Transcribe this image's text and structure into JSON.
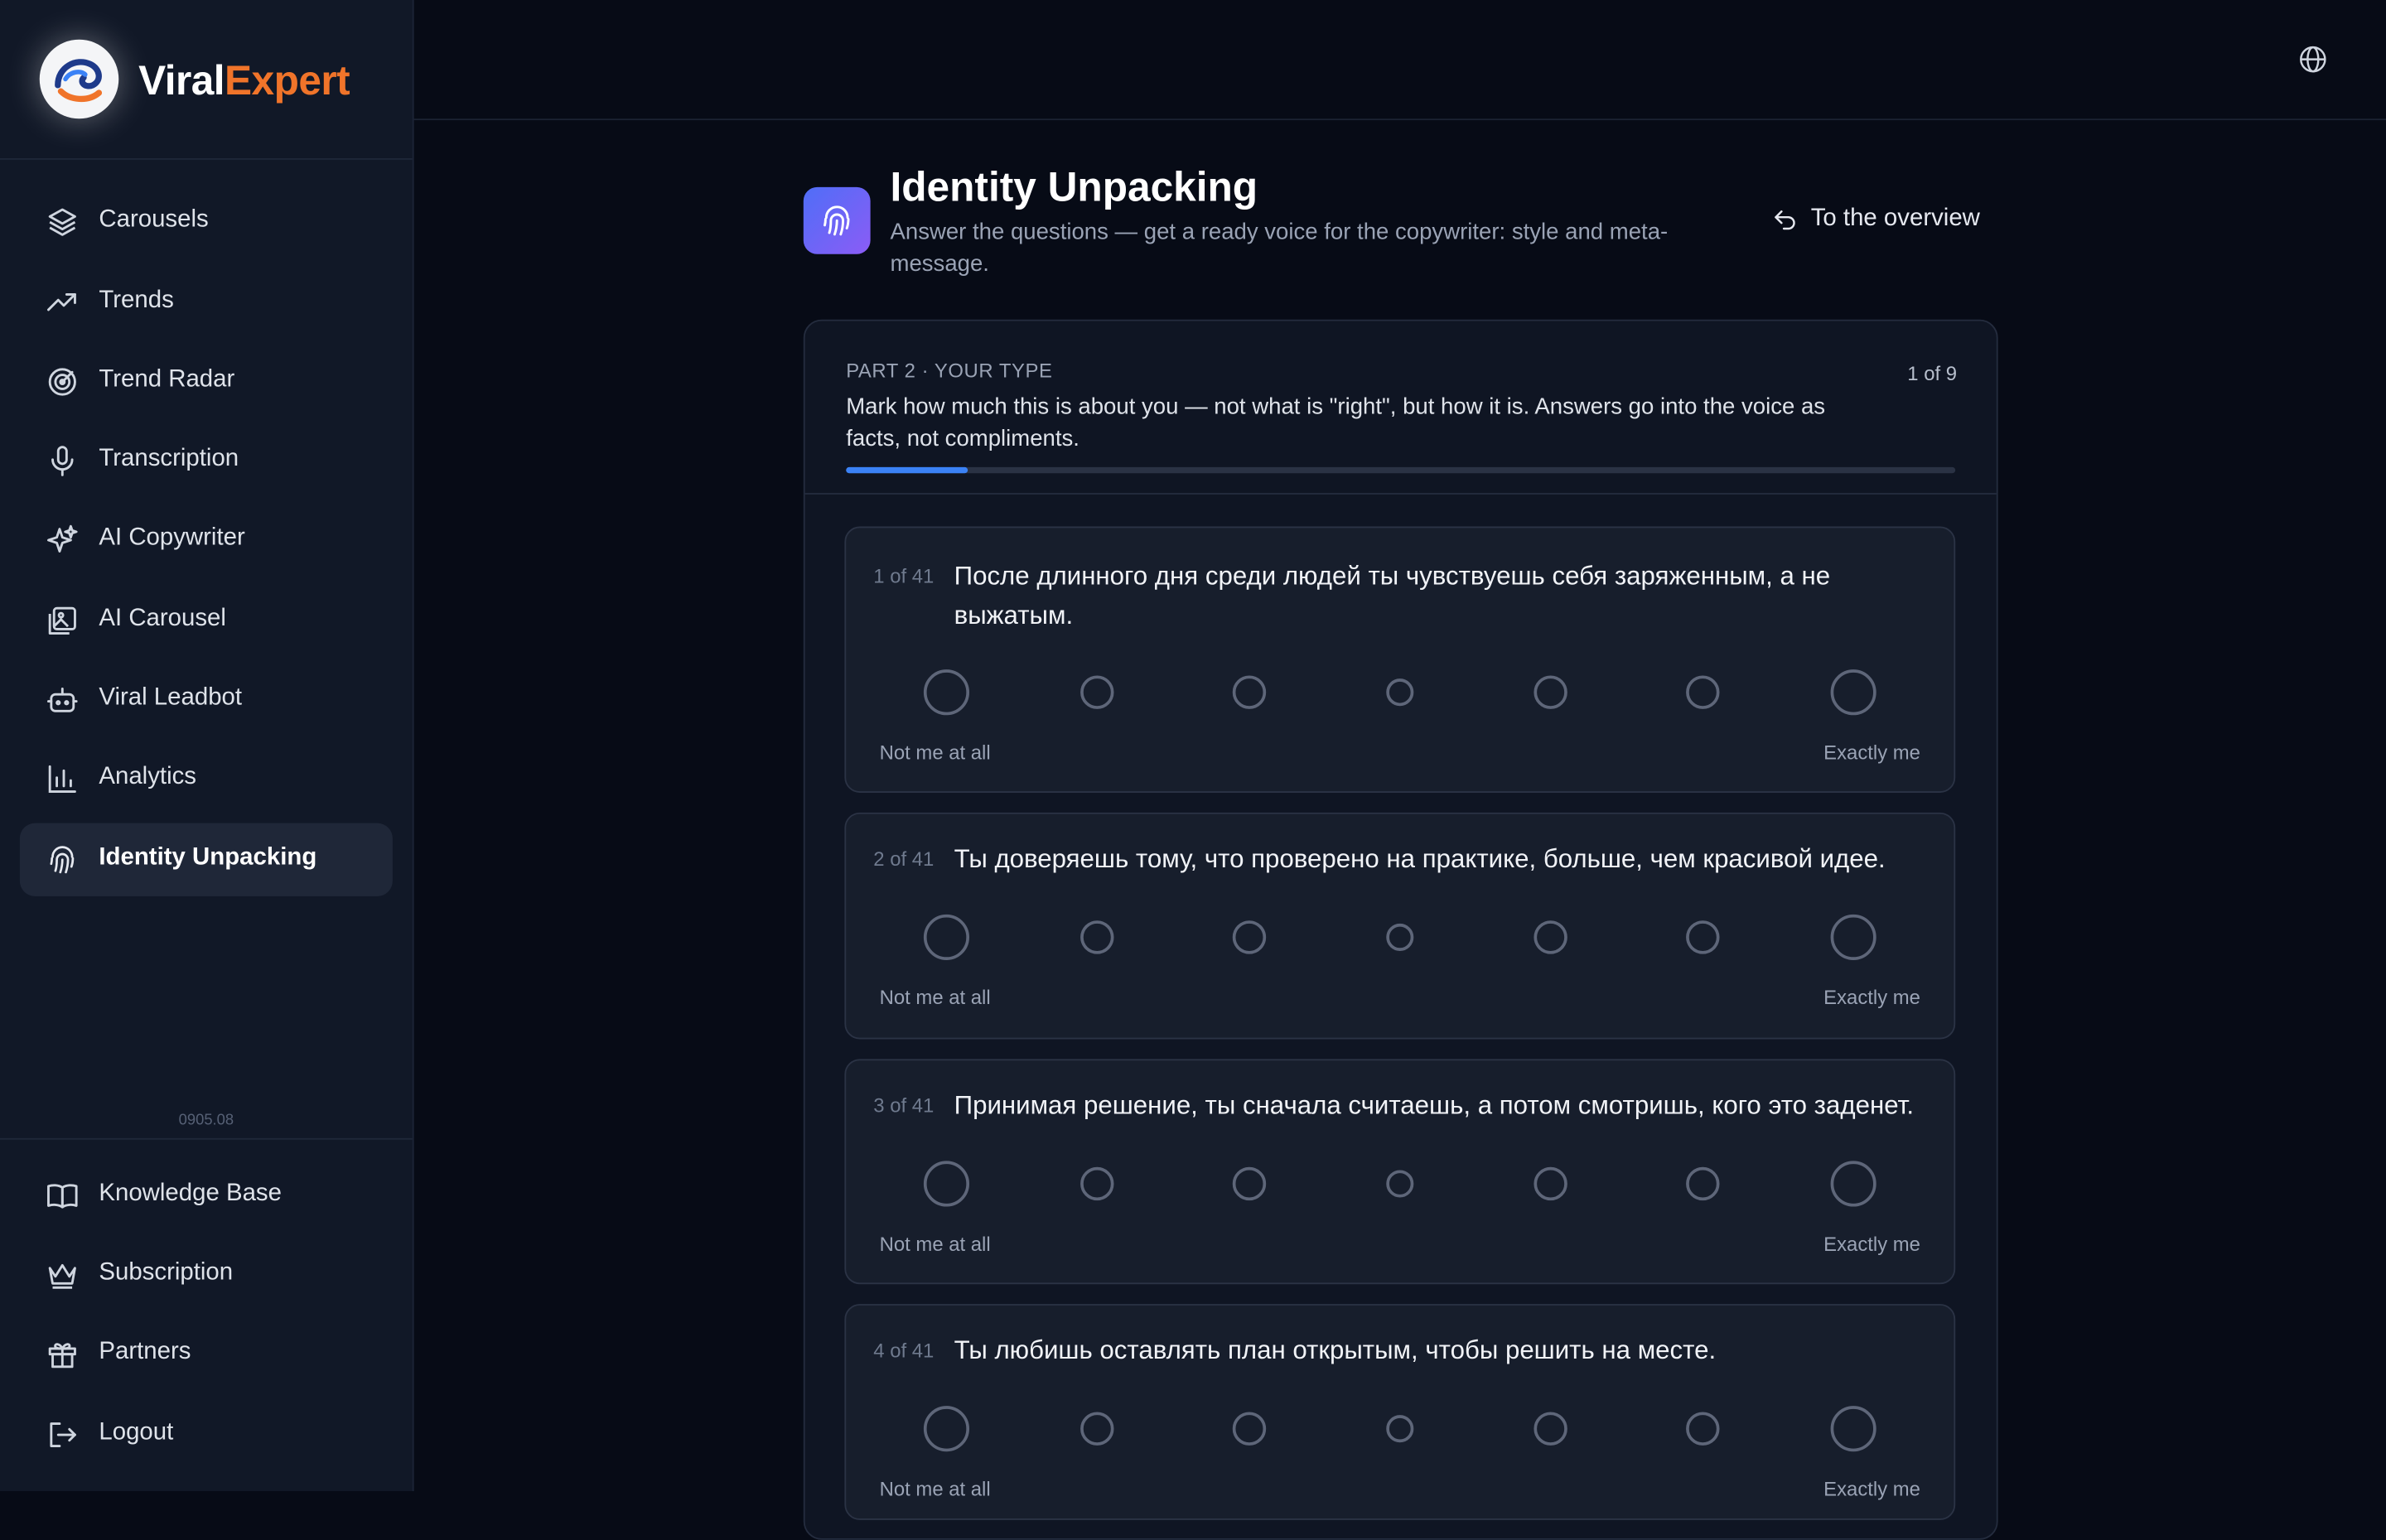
{
  "brand": {
    "name_part1": "Viral",
    "name_part2": "Expert"
  },
  "sidebar": {
    "items": [
      {
        "label": "Carousels",
        "icon": "layers-icon"
      },
      {
        "label": "Trends",
        "icon": "trending-up-icon"
      },
      {
        "label": "Trend Radar",
        "icon": "radar-icon"
      },
      {
        "label": "Transcription",
        "icon": "microphone-icon"
      },
      {
        "label": "AI Copywriter",
        "icon": "sparkles-icon"
      },
      {
        "label": "AI Carousel",
        "icon": "image-stack-icon"
      },
      {
        "label": "Viral Leadbot",
        "icon": "bot-icon"
      },
      {
        "label": "Analytics",
        "icon": "bar-chart-icon"
      },
      {
        "label": "Identity Unpacking",
        "icon": "fingerprint-icon",
        "active": true
      }
    ],
    "version": "0905.08",
    "bottom_items": [
      {
        "label": "Knowledge Base",
        "icon": "book-icon"
      },
      {
        "label": "Subscription",
        "icon": "crown-icon"
      },
      {
        "label": "Partners",
        "icon": "gift-icon"
      },
      {
        "label": "Logout",
        "icon": "logout-icon"
      }
    ]
  },
  "header": {
    "title": "Identity Unpacking",
    "subtitle": "Answer the questions — get a ready voice for the copywriter: style and meta-message.",
    "overview_link": "To the overview"
  },
  "section": {
    "part_label": "PART 2 · YOUR TYPE",
    "counter": "1 of 9",
    "instructions": "Mark how much this is about you — not what is \"right\", but how it is. Answers go into the voice as facts, not compliments.",
    "progress": 0.11
  },
  "scale_labels": {
    "low": "Not me at all",
    "high": "Exactly me"
  },
  "questions": [
    {
      "number": "1 of 41",
      "text": "После длинного дня среди людей ты чувствуешь себя заряженным, а не выжатым."
    },
    {
      "number": "2 of 41",
      "text": "Ты доверяешь тому, что проверено на практике, больше, чем красивой идее."
    },
    {
      "number": "3 of 41",
      "text": "Принимая решение, ты сначала считаешь, а потом смотришь, кого это заденет."
    },
    {
      "number": "4 of 41",
      "text": "Ты любишь оставлять план открытым, чтобы решить на месте."
    }
  ],
  "colors": {
    "accent": "#3b82f6",
    "brand_orange": "#f0742a",
    "background": "#070b16"
  }
}
